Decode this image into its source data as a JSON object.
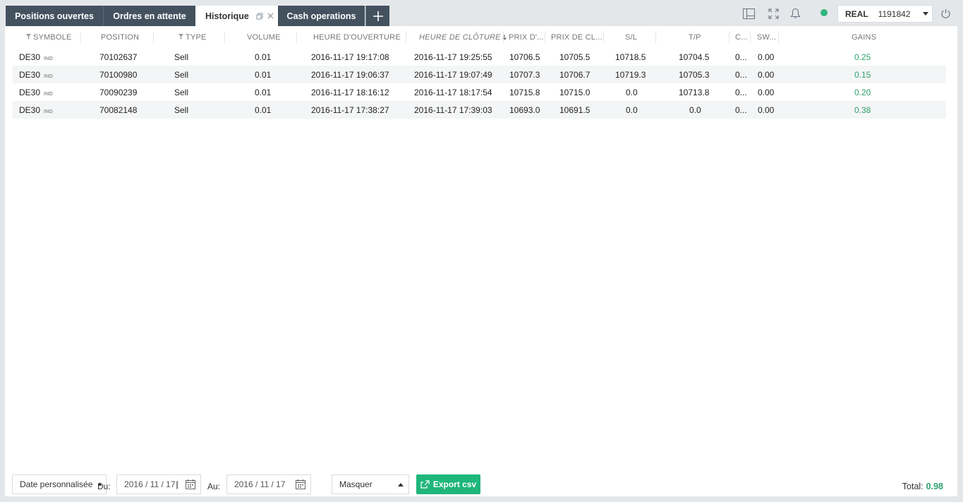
{
  "tabs": [
    {
      "label": "Positions ouvertes"
    },
    {
      "label": "Ordres en attente"
    },
    {
      "label": "Historique"
    },
    {
      "label": "Cash operations"
    }
  ],
  "account": {
    "type": "REAL",
    "number": "1191842",
    "status_color": "#2eb67d"
  },
  "columns": [
    "SYMBOLE",
    "POSITION",
    "TYPE",
    "VOLUME",
    "HEURE D'OUVERTURE",
    "HEURE DE CLÔTURE",
    "PRIX D'...",
    "PRIX DE CL...",
    "S/L",
    "T/P",
    "C...",
    "SW...",
    "GAINS"
  ],
  "rows": [
    {
      "symbol": "DE30",
      "tag": "IND",
      "position": "70102637",
      "type": "Sell",
      "volume": "0.01",
      "open_time": "2016-11-17 19:17:08",
      "close_time": "2016-11-17 19:25:55",
      "open_price": "10706.5",
      "close_price": "10705.5",
      "sl": "10718.5",
      "tp": "10704.5",
      "comm": "0...",
      "swap": "0.00",
      "gain": "0.25"
    },
    {
      "symbol": "DE30",
      "tag": "IND",
      "position": "70100980",
      "type": "Sell",
      "volume": "0.01",
      "open_time": "2016-11-17 19:06:37",
      "close_time": "2016-11-17 19:07:49",
      "open_price": "10707.3",
      "close_price": "10706.7",
      "sl": "10719.3",
      "tp": "10705.3",
      "comm": "0...",
      "swap": "0.00",
      "gain": "0.15"
    },
    {
      "symbol": "DE30",
      "tag": "IND",
      "position": "70090239",
      "type": "Sell",
      "volume": "0.01",
      "open_time": "2016-11-17 18:16:12",
      "close_time": "2016-11-17 18:17:54",
      "open_price": "10715.8",
      "close_price": "10715.0",
      "sl": "0.0",
      "tp": "10713.8",
      "comm": "0...",
      "swap": "0.00",
      "gain": "0.20"
    },
    {
      "symbol": "DE30",
      "tag": "IND",
      "position": "70082148",
      "type": "Sell",
      "volume": "0.01",
      "open_time": "2016-11-17 17:38:27",
      "close_time": "2016-11-17 17:39:03",
      "open_price": "10693.0",
      "close_price": "10691.5",
      "sl": "0.0",
      "tp": "0.0",
      "comm": "0...",
      "swap": "0.00",
      "gain": "0.38"
    }
  ],
  "footer": {
    "date_preset": "Date personnalisée",
    "from_label": "Du:",
    "from_value": "2016 / 11 / 17",
    "to_label": "Au:",
    "to_value": "2016 / 11 / 17",
    "filter_value": "Masquer",
    "export_label": "Export csv",
    "total_label": "Total:",
    "total_value": "0.98"
  },
  "colors": {
    "accent": "#1fb67a",
    "tab_bg": "#44525f",
    "gain": "#2fa26d"
  }
}
